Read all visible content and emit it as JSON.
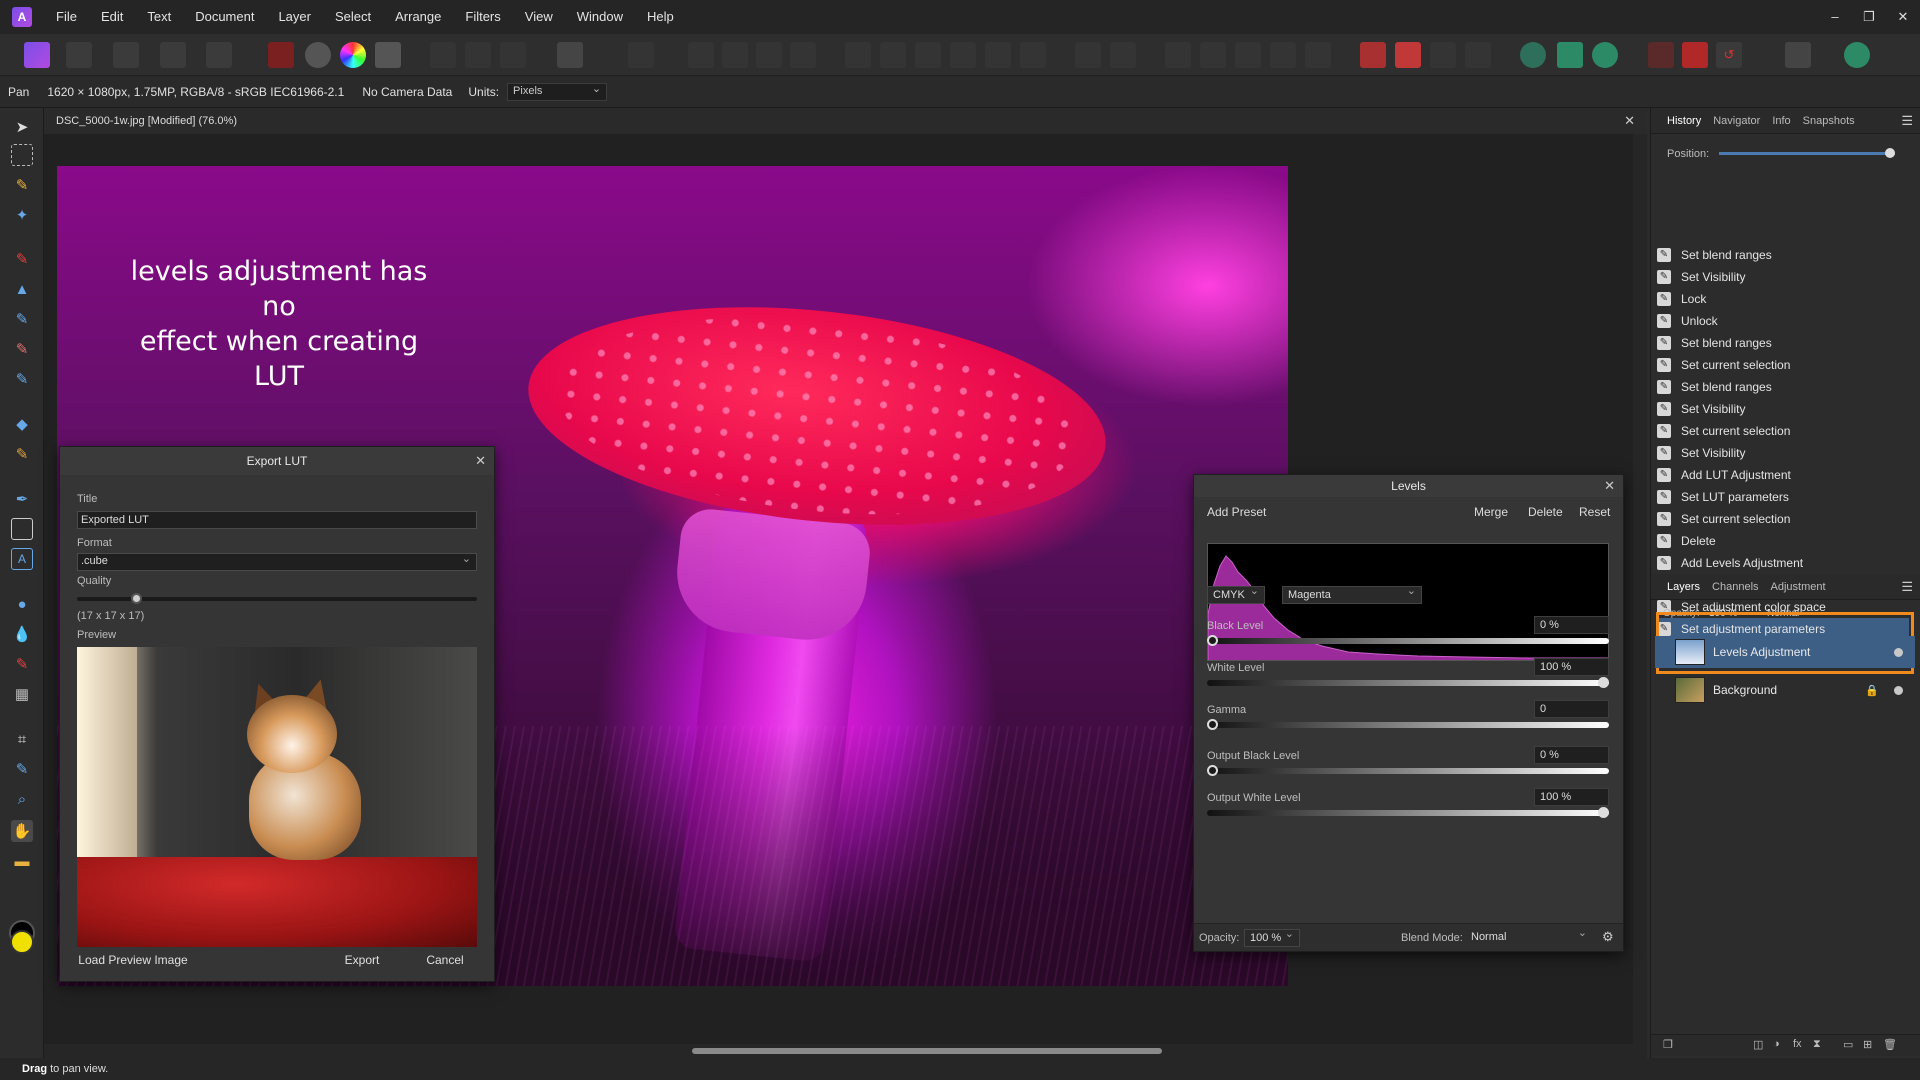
{
  "menubar": {
    "items": [
      "File",
      "Edit",
      "Text",
      "Document",
      "Layer",
      "Select",
      "Arrange",
      "Filters",
      "View",
      "Window",
      "Help"
    ],
    "logo_icon": "affinity-photo-icon",
    "window_controls": [
      "–",
      "❐",
      "✕"
    ]
  },
  "contextbar": {
    "tool": "Pan",
    "doc_info": "1620 × 1080px, 1.75MP, RGBA/8 - sRGB IEC61966-2.1",
    "camera": "No Camera Data",
    "units_label": "Units:",
    "units_value": "Pixels"
  },
  "document": {
    "tab_title": "DSC_5000-1w.jpg [Modified] (76.0%)",
    "caption_line1": "levels adjustment has no",
    "caption_line2": "effect when creating LUT"
  },
  "export_lut": {
    "title": "Export LUT",
    "title_label": "Title",
    "title_value": "Exported LUT",
    "format_label": "Format",
    "format_value": ".cube",
    "quality_label": "Quality",
    "quality_level": 0.14,
    "quality_dims": "(17 x 17 x 17)",
    "preview_label": "Preview",
    "load_preview_label": "Load Preview Image",
    "export_label": "Export",
    "cancel_label": "Cancel"
  },
  "levels": {
    "title": "Levels",
    "add_preset": "Add Preset",
    "merge": "Merge",
    "delete": "Delete",
    "reset": "Reset",
    "colorspace": "CMYK",
    "channel": "Magenta",
    "black_level_label": "Black Level",
    "black_level_value": "0 %",
    "white_level_label": "White Level",
    "white_level_value": "100 %",
    "gamma_label": "Gamma",
    "gamma_value": "0",
    "output_black_label": "Output Black Level",
    "output_black_value": "0 %",
    "output_white_label": "Output White Level",
    "output_white_value": "100 %",
    "opacity_label": "Opacity:",
    "opacity_value": "100 %",
    "blend_label": "Blend Mode:",
    "blend_value": "Normal"
  },
  "history_panel": {
    "tabs": [
      "History",
      "Navigator",
      "Info",
      "Snapshots"
    ],
    "position_label": "Position:",
    "position_level": 1.0,
    "items": [
      "Set blend ranges",
      "Set Visibility",
      "Lock",
      "Unlock",
      "Set blend ranges",
      "Set current selection",
      "Set blend ranges",
      "Set Visibility",
      "Set current selection",
      "Set Visibility",
      "Add LUT Adjustment",
      "Set LUT parameters",
      "Set current selection",
      "Delete",
      "Add Levels Adjustment",
      "Set adjustment parameters",
      "Set adjustment color space",
      "Set adjustment parameters"
    ],
    "active_index": 17
  },
  "layers_panel": {
    "tabs": [
      "Layers",
      "Channels",
      "Adjustment"
    ],
    "opacity_label": "Opacity:",
    "opacity_value": "100 %",
    "blend_value": "Normal",
    "layers": [
      {
        "name": "Levels Adjustment",
        "selected": true
      },
      {
        "name": "Background",
        "selected": false,
        "locked": true
      }
    ],
    "highlight_color": "#f08a1c"
  },
  "statusbar": {
    "action": "Drag",
    "message": " to pan view."
  },
  "colors": {
    "accent_selected": "#3d5f86",
    "primary_color": "#000000",
    "secondary_color": "#f0e000"
  }
}
